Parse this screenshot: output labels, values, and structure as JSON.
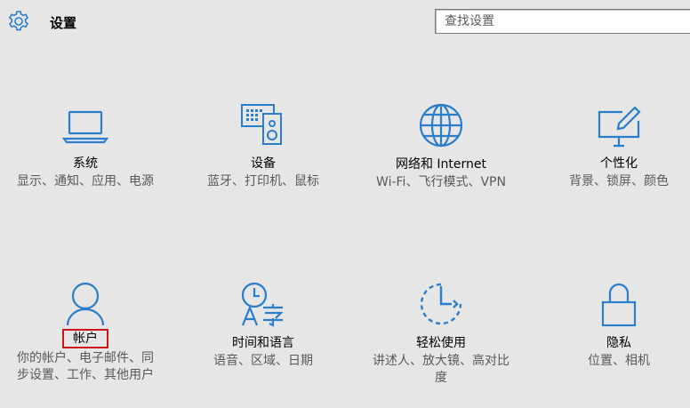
{
  "header": {
    "title": "设置",
    "gear_icon": "gear-icon"
  },
  "search": {
    "placeholder": "查找设置"
  },
  "accent_color": "#2a7ecb",
  "highlight_color": "#cc1616",
  "tiles": [
    {
      "title": "系统",
      "desc": "显示、通知、应用、电源",
      "icon": "laptop-icon"
    },
    {
      "title": "设备",
      "desc": "蓝牙、打印机、鼠标",
      "icon": "devices-icon"
    },
    {
      "title": "网络和 Internet",
      "desc": "Wi-Fi、飞行模式、VPN",
      "icon": "globe-icon"
    },
    {
      "title": "个性化",
      "desc": "背景、锁屏、颜色",
      "icon": "personalization-icon"
    },
    {
      "title": "帐户",
      "desc": "你的帐户、电子邮件、同步设置、工作、其他用户",
      "icon": "person-icon",
      "highlighted": true
    },
    {
      "title": "时间和语言",
      "desc": "语音、区域、日期",
      "icon": "time-language-icon"
    },
    {
      "title": "轻松使用",
      "desc": "讲述人、放大镜、高对比度",
      "icon": "ease-of-access-icon"
    },
    {
      "title": "隐私",
      "desc": "位置、相机",
      "icon": "lock-icon"
    }
  ]
}
